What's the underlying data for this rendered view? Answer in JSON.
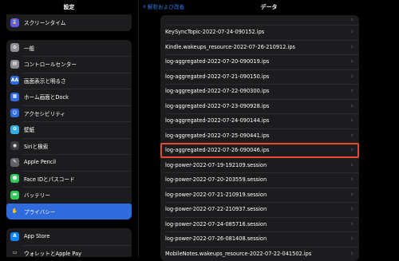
{
  "sidebar": {
    "title": "設定",
    "top_items": [
      {
        "label": "スクリーンタイム",
        "icon": "hourglass-icon",
        "color": "#5e5ce6",
        "glyph": "⌛"
      }
    ],
    "main_items": [
      {
        "label": "一般",
        "icon": "gear-icon",
        "color": "#8e8e93",
        "glyph": "⚙"
      },
      {
        "label": "コントロールセンター",
        "icon": "control-center-icon",
        "color": "#8e8e93",
        "glyph": "▤"
      },
      {
        "label": "画面表示と明るさ",
        "icon": "display-aa-icon",
        "color": "#2f6bdc",
        "glyph": "AA"
      },
      {
        "label": "ホーム画面とDock",
        "icon": "home-screen-icon",
        "color": "#2f6bdc",
        "glyph": "▦"
      },
      {
        "label": "アクセシビリティ",
        "icon": "accessibility-icon",
        "color": "#2f6bdc",
        "glyph": "☺"
      },
      {
        "label": "壁紙",
        "icon": "wallpaper-icon",
        "color": "#32ade6",
        "glyph": "✿"
      },
      {
        "label": "Siriと検索",
        "icon": "siri-icon",
        "color": "#3a3a3c",
        "glyph": "◉"
      },
      {
        "label": "Apple Pencil",
        "icon": "pencil-icon",
        "color": "#636366",
        "glyph": "✎"
      },
      {
        "label": "Face IDとパスコード",
        "icon": "face-id-icon",
        "color": "#34c759",
        "glyph": "☻"
      },
      {
        "label": "バッテリー",
        "icon": "battery-icon",
        "color": "#34c759",
        "glyph": "▬"
      },
      {
        "label": "プライバシー",
        "icon": "privacy-hand-icon",
        "color": "#2f6bdc",
        "glyph": "✋"
      }
    ],
    "selected_index": 10,
    "store_items": [
      {
        "label": "App Store",
        "icon": "app-store-icon",
        "color": "#0a84ff",
        "glyph": "A"
      },
      {
        "label": "ウォレットとApple Pay",
        "icon": "wallet-icon",
        "color": "#1c1c1e",
        "glyph": "▭"
      }
    ]
  },
  "detail": {
    "back_label": "解析および改善",
    "title": "データ",
    "highlight_index": 9,
    "rows": [
      "",
      "KeySyncTopic-2022-07-24-090152.ips",
      "Kindle.wakeups_resource-2022-07-26-210912.ips",
      "log-aggregated-2022-07-20-090019.ips",
      "log-aggregated-2022-07-21-090150.ips",
      "log-aggregated-2022-07-22-090300.ips",
      "log-aggregated-2022-07-23-090928.ips",
      "log-aggregated-2022-07-24-090144.ips",
      "log-aggregated-2022-07-25-090441.ips",
      "log-aggregated-2022-07-26-090046.ips",
      "log-power-2022-07-19-192109.session",
      "log-power-2022-07-20-203559.session",
      "log-power-2022-07-21-210919.session",
      "log-power-2022-07-22-210937.session",
      "log-power-2022-07-24-085716.session",
      "log-power-2022-07-26-081408.session",
      "MobileNotes.wakeups_resource-2022-07-22-041502.ips"
    ]
  }
}
